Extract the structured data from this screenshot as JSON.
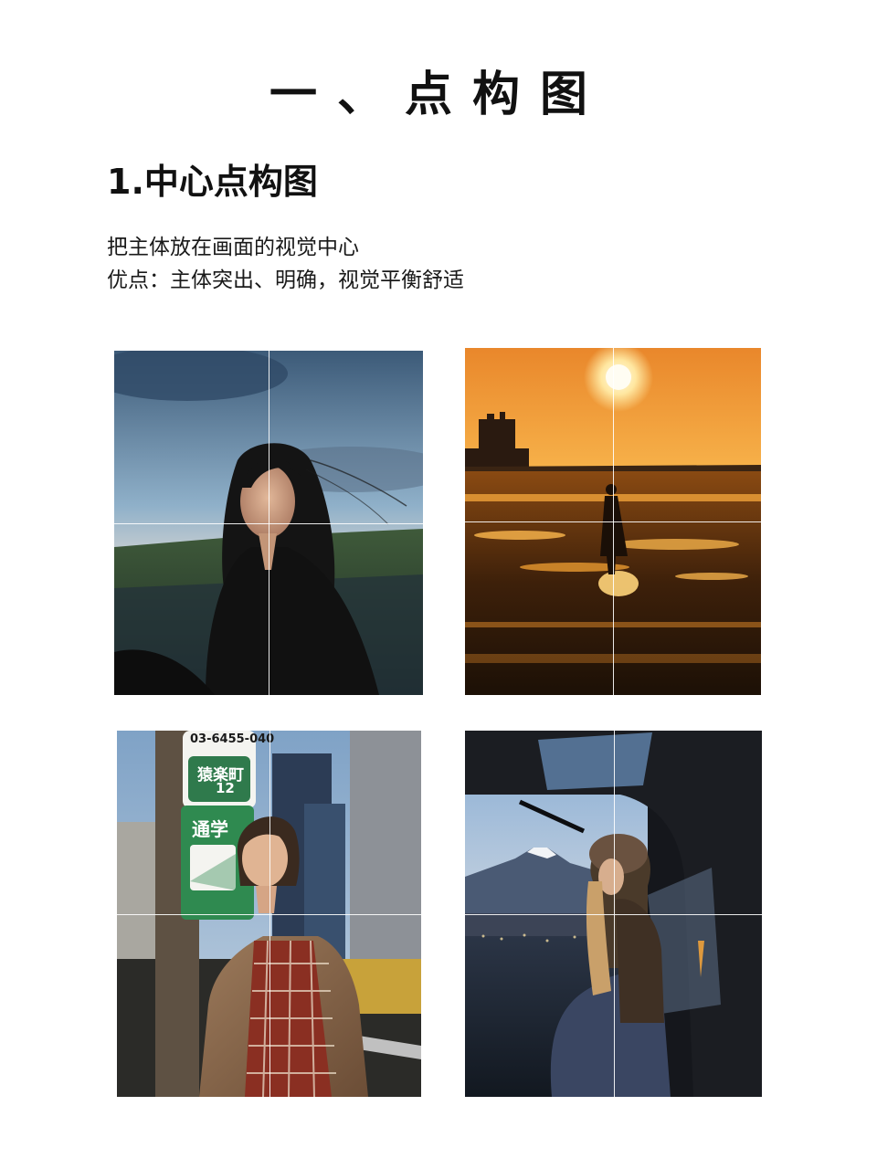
{
  "page": {
    "title": "一、点构图",
    "section_heading": "1.中心点构图",
    "description_line1": "把主体放在画面的视觉中心",
    "description_line2": "优点：主体突出、明确，视觉平衡舒适"
  },
  "photos": [
    {
      "subject": "portrait-woman-windblown-hair"
    },
    {
      "subject": "silhouette-sunset-beach"
    },
    {
      "subject": "woman-street-sign-pole",
      "sign_phone": "03-6455-040",
      "sign_place": "猿楽町",
      "sign_number": "12",
      "sign_green": "通学"
    },
    {
      "subject": "woman-in-car-mount-fuji"
    }
  ],
  "colors": {
    "text": "#111111",
    "grid_line": "#ffffff",
    "sunset_orange": "#f29a1f"
  }
}
